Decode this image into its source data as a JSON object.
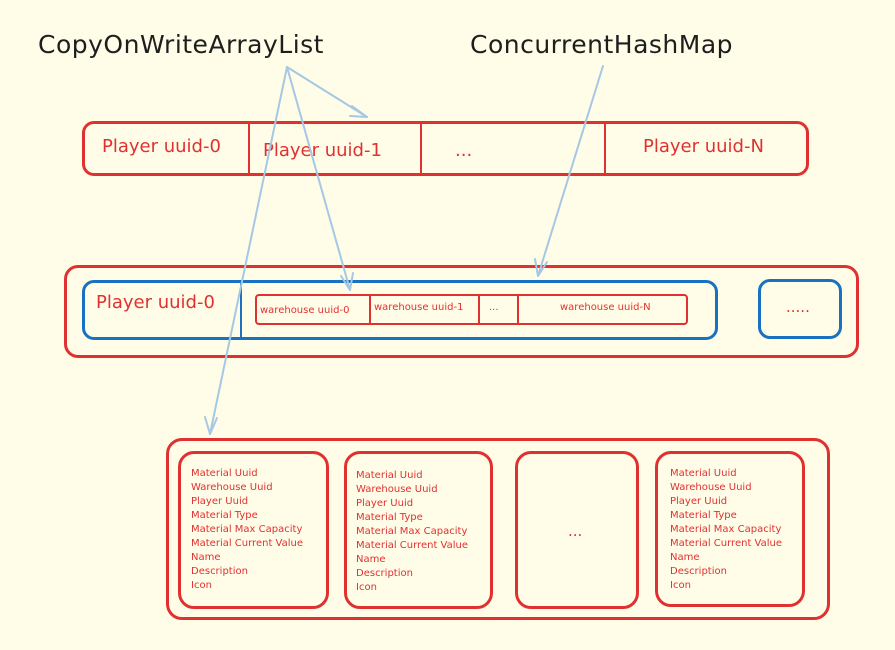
{
  "labels": {
    "cow_list": "CopyOnWriteArrayList",
    "chm": "ConcurrentHashMap"
  },
  "players_row": {
    "cells": [
      "Player uuid-0",
      "Player uuid-1",
      "...",
      "Player uuid-N"
    ]
  },
  "warehouse_row": {
    "player": "Player uuid-0",
    "warehouses": [
      "warehouse uuid-0",
      "warehouse uuid-1",
      "...",
      "warehouse uuid-N"
    ],
    "more": "....."
  },
  "materials_row": {
    "fields": [
      "Material Uuid",
      "Warehouse Uuid",
      "Player Uuid",
      "Material Type",
      "Material Max Capacity",
      "Material Current Value",
      "Name",
      "Description",
      "Icon"
    ],
    "ellipsis": "..."
  },
  "colors": {
    "red": "#e03131",
    "blue": "#1971c2",
    "arrow": "#a5c8e4",
    "background": "#fffce8"
  }
}
